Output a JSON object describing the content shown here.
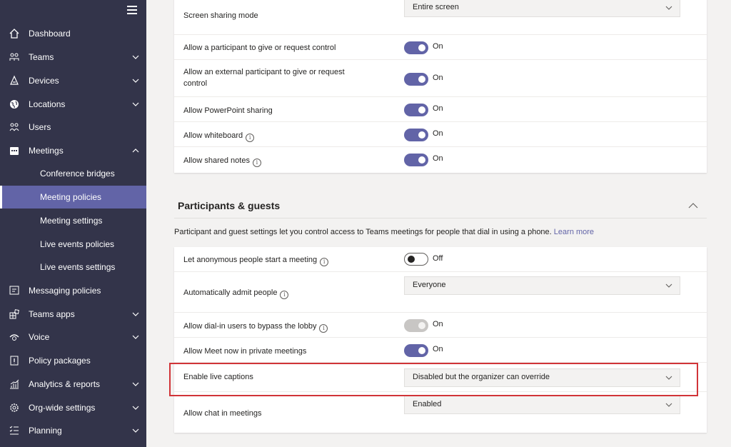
{
  "sidebar": {
    "items": [
      {
        "label": "Dashboard",
        "icon": "home-icon"
      },
      {
        "label": "Teams",
        "icon": "teams-icon"
      },
      {
        "label": "Devices",
        "icon": "devices-icon"
      },
      {
        "label": "Locations",
        "icon": "globe-icon"
      },
      {
        "label": "Users",
        "icon": "users-icon"
      },
      {
        "label": "Meetings",
        "icon": "calendar-icon"
      },
      {
        "label": "Conference bridges"
      },
      {
        "label": "Meeting policies"
      },
      {
        "label": "Meeting settings"
      },
      {
        "label": "Live events policies"
      },
      {
        "label": "Live events settings"
      },
      {
        "label": "Messaging policies",
        "icon": "message-icon"
      },
      {
        "label": "Teams apps",
        "icon": "apps-icon"
      },
      {
        "label": "Voice",
        "icon": "voice-icon"
      },
      {
        "label": "Policy packages",
        "icon": "package-icon"
      },
      {
        "label": "Analytics & reports",
        "icon": "analytics-icon"
      },
      {
        "label": "Org-wide settings",
        "icon": "gear-icon"
      },
      {
        "label": "Planning",
        "icon": "planning-icon"
      }
    ]
  },
  "content_sharing": {
    "rows": [
      {
        "label": "Screen sharing mode",
        "value": "Entire screen"
      },
      {
        "label": "Allow a participant to give or request control",
        "value": "On"
      },
      {
        "label": "Allow an external participant to give or request",
        "label2": "control",
        "value": "On"
      },
      {
        "label": "Allow PowerPoint sharing",
        "value": "On"
      },
      {
        "label": "Allow whiteboard",
        "value": "On"
      },
      {
        "label": "Allow shared notes",
        "value": "On"
      }
    ]
  },
  "participants": {
    "title": "Participants & guests",
    "description": "Participant and guest settings let you control access to Teams meetings for people that dial in using a phone.",
    "learn_more": "Learn more",
    "rows": [
      {
        "label": "Let anonymous people start a meeting",
        "value": "Off"
      },
      {
        "label": "Automatically admit people",
        "value": "Everyone"
      },
      {
        "label": "Allow dial-in users to bypass the lobby",
        "value": "On"
      },
      {
        "label": "Allow Meet now in private meetings",
        "value": "On"
      },
      {
        "label": "Enable live captions",
        "value": "Disabled but the organizer can override"
      },
      {
        "label": "Allow chat in meetings",
        "value": "Enabled"
      }
    ]
  },
  "info_glyph": "i",
  "colors": {
    "sidebar": "#33344a",
    "accent": "#6264a7",
    "highlight": "#d13438"
  }
}
